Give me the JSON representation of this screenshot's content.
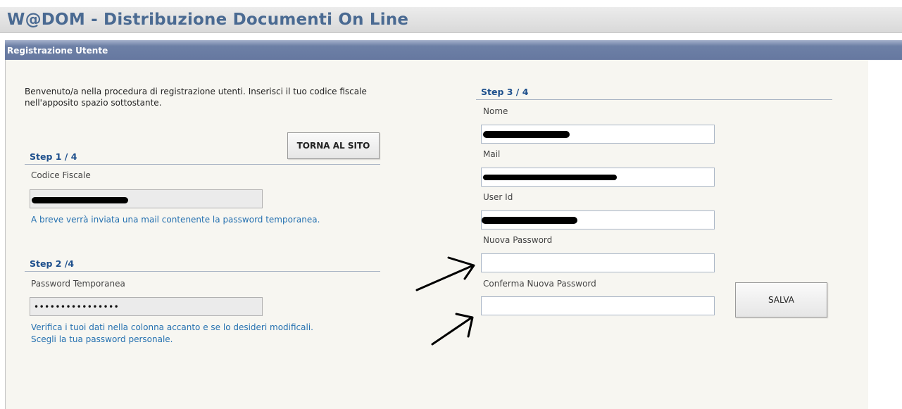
{
  "app": {
    "title": "W@DOM - Distribuzione Documenti On Line"
  },
  "panel": {
    "title": "Registrazione Utente"
  },
  "intro": "Benvenuto/a nella procedura di registrazione utenti. Inserisci il tuo codice fiscale nell'apposito spazio sottostante.",
  "buttons": {
    "back_label": "TORNA AL SITO",
    "save_label": "SALVA"
  },
  "step1": {
    "title": "Step 1 / 4",
    "label": "Codice Fiscale",
    "value": "",
    "note": "A breve verrà inviata una mail contenente la password temporanea."
  },
  "step2": {
    "title": "Step 2 /4",
    "label": "Password Temporanea",
    "value": "••••••••••••••••",
    "note_line1": "Verifica i tuoi dati nella colonna accanto e se lo desideri modificali.",
    "note_line2": "Scegli la tua password personale."
  },
  "step3": {
    "title": "Step 3 / 4",
    "name_label": "Nome",
    "mail_label": "Mail",
    "userid_label": "User Id",
    "newpass_label": "Nuova Password",
    "confirm_label": "Conferma Nuova Password"
  },
  "colors": {
    "accent": "#1d4f8c",
    "note": "#2470b0",
    "panel_bar": "#6678a0",
    "title": "#4a6a92"
  },
  "annotations": {
    "arrow_count": 2
  }
}
